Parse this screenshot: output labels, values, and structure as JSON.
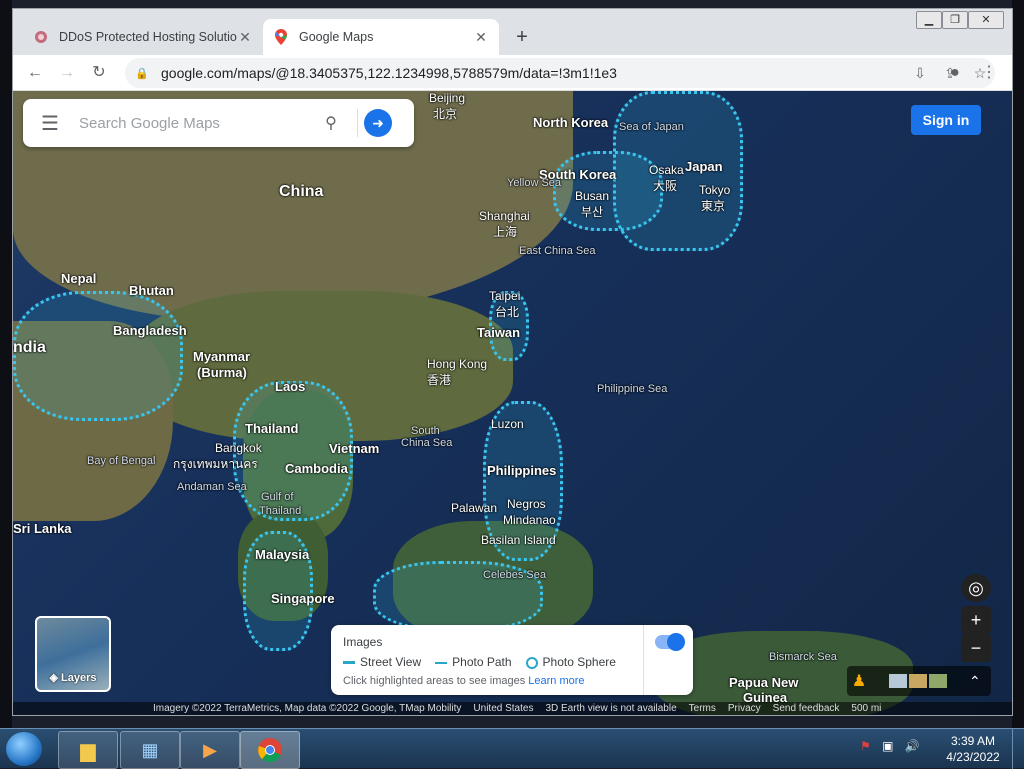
{
  "browser": {
    "tabs": [
      {
        "title": "DDoS Protected Hosting Solution"
      },
      {
        "title": "Google Maps"
      }
    ],
    "url": "google.com/maps/@18.3405375,122.1234998,5788579m/data=!3m1!1e3"
  },
  "maps": {
    "search_placeholder": "Search Google Maps",
    "sign_in": "Sign in",
    "layers_label": "Layers",
    "images_panel": {
      "title": "Images",
      "street_view": "Street View",
      "photo_path": "Photo Path",
      "photo_sphere": "Photo Sphere",
      "hint": "Click highlighted areas to see images",
      "learn_more": "Learn more",
      "toggle_on": true
    },
    "labels": {
      "beijing": "Beijing",
      "beijing_local": "北京",
      "north_korea": "North Korea",
      "sea_of_japan": "Sea of Japan",
      "south_korea": "South Korea",
      "osaka": "Osaka",
      "osaka_local": "大阪",
      "japan": "Japan",
      "tokyo": "Tokyo",
      "tokyo_local": "東京",
      "yellow_sea": "Yellow Sea",
      "busan": "Busan",
      "busan_local": "부산",
      "china": "China",
      "shanghai": "Shanghai",
      "shanghai_local": "上海",
      "east_china_sea": "East China Sea",
      "nepal": "Nepal",
      "bhutan": "Bhutan",
      "taipei": "Taipei",
      "taipei_local": "台北",
      "taiwan": "Taiwan",
      "bangladesh": "Bangladesh",
      "india": "ndia",
      "myanmar": "Myanmar",
      "burma": "(Burma)",
      "hong_kong": "Hong Kong",
      "hong_kong_local": "香港",
      "laos": "Laos",
      "philippine_sea": "Philippine Sea",
      "thailand": "Thailand",
      "bangkok": "Bangkok",
      "bangkok_local": "กรุงเทพมหานคร",
      "vietnam": "Vietnam",
      "south_china_sea_1": "South",
      "south_china_sea_2": "China Sea",
      "luzon": "Luzon",
      "bay_of_bengal": "Bay of Bengal",
      "cambodia": "Cambodia",
      "philippines": "Philippines",
      "andaman_sea": "Andaman Sea",
      "gulf_1": "Gulf of",
      "gulf_2": "Thailand",
      "palawan": "Palawan",
      "negros": "Negros",
      "mindanao": "Mindanao",
      "sri_lanka": "Sri Lanka",
      "malaysia": "Malaysia",
      "basilan": "Basilan Island",
      "celebes_sea": "Celebes Sea",
      "singapore": "Singapore",
      "bismarck_sea": "Bismarck Sea",
      "papua_1": "Papua New",
      "papua_2": "Guinea"
    },
    "footer": {
      "imagery": "Imagery ©2022 TerraMetrics, Map data ©2022 Google, TMap Mobility",
      "country": "United States",
      "earth": "3D Earth view is not available",
      "terms": "Terms",
      "privacy": "Privacy",
      "feedback": "Send feedback",
      "scale": "500 mi"
    }
  },
  "taskbar": {
    "time": "3:39 AM",
    "date": "4/23/2022"
  }
}
